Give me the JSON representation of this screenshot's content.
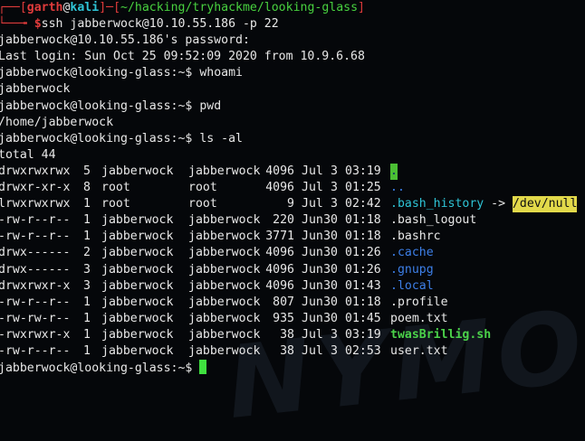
{
  "prompt_header": {
    "open": "┌──[",
    "user": "garth",
    "at": "@",
    "host": "kali",
    "mid": "]─[",
    "path": "~/hacking/tryhackme/looking-glass",
    "close": "]",
    "arrow": "└──╼ ",
    "dollar": "$",
    "command": "ssh jabberwock@10.10.55.186 -p 22"
  },
  "lines": {
    "password": "jabberwock@10.10.55.186's password:",
    "last_login": "Last login: Sun Oct 25 09:52:09 2020 from 10.9.6.68",
    "whoami_prompt": "jabberwock@looking-glass:~$ ",
    "whoami_cmd": "whoami",
    "whoami_out": "jabberwock",
    "pwd_prompt": "jabberwock@looking-glass:~$ ",
    "pwd_cmd": "pwd",
    "pwd_out": "/home/jabberwock",
    "ls_prompt": "jabberwock@looking-glass:~$ ",
    "ls_cmd": "ls -al",
    "total": "total 44",
    "final_prompt": "jabberwock@looking-glass:~$ "
  },
  "ls_rows": [
    {
      "perm": "drwxrwxrwx",
      "n": "5",
      "owner": "jabberwock",
      "group": "jabberwock",
      "size": "4096",
      "mon": "Jul",
      "day": "3",
      "time": "03:19",
      "name": ".",
      "kind": "dir-hl"
    },
    {
      "perm": "drwxr-xr-x",
      "n": "8",
      "owner": "root",
      "group": "root",
      "size": "4096",
      "mon": "Jul",
      "day": "3",
      "time": "01:25",
      "name": "..",
      "kind": "dir"
    },
    {
      "perm": "lrwxrwxrwx",
      "n": "1",
      "owner": "root",
      "group": "root",
      "size": "9",
      "mon": "Jul",
      "day": "3",
      "time": "02:42",
      "name": ".bash_history",
      "target": "/dev/null",
      "arrow": " -> ",
      "kind": "link"
    },
    {
      "perm": "-rw-r--r--",
      "n": "1",
      "owner": "jabberwock",
      "group": "jabberwock",
      "size": "220",
      "mon": "Jun",
      "day": "30",
      "time": "01:18",
      "name": ".bash_logout",
      "kind": "file"
    },
    {
      "perm": "-rw-r--r--",
      "n": "1",
      "owner": "jabberwock",
      "group": "jabberwock",
      "size": "3771",
      "mon": "Jun",
      "day": "30",
      "time": "01:18",
      "name": ".bashrc",
      "kind": "file"
    },
    {
      "perm": "drwx------",
      "n": "2",
      "owner": "jabberwock",
      "group": "jabberwock",
      "size": "4096",
      "mon": "Jun",
      "day": "30",
      "time": "01:26",
      "name": ".cache",
      "kind": "dir"
    },
    {
      "perm": "drwx------",
      "n": "3",
      "owner": "jabberwock",
      "group": "jabberwock",
      "size": "4096",
      "mon": "Jun",
      "day": "30",
      "time": "01:26",
      "name": ".gnupg",
      "kind": "dir"
    },
    {
      "perm": "drwxrwxr-x",
      "n": "3",
      "owner": "jabberwock",
      "group": "jabberwock",
      "size": "4096",
      "mon": "Jun",
      "day": "30",
      "time": "01:43",
      "name": ".local",
      "kind": "dir"
    },
    {
      "perm": "-rw-r--r--",
      "n": "1",
      "owner": "jabberwock",
      "group": "jabberwock",
      "size": "807",
      "mon": "Jun",
      "day": "30",
      "time": "01:18",
      "name": ".profile",
      "kind": "file"
    },
    {
      "perm": "-rw-rw-r--",
      "n": "1",
      "owner": "jabberwock",
      "group": "jabberwock",
      "size": "935",
      "mon": "Jun",
      "day": "30",
      "time": "01:45",
      "name": "poem.txt",
      "kind": "file"
    },
    {
      "perm": "-rwxrwxr-x",
      "n": "1",
      "owner": "jabberwock",
      "group": "jabberwock",
      "size": "38",
      "mon": "Jul",
      "day": "3",
      "time": "03:19",
      "name": "twasBrillig.sh",
      "kind": "exec"
    },
    {
      "perm": "-rw-r--r--",
      "n": "1",
      "owner": "jabberwock",
      "group": "jabberwock",
      "size": "38",
      "mon": "Jul",
      "day": "3",
      "time": "02:53",
      "name": "user.txt",
      "kind": "file"
    }
  ],
  "colors": {
    "background": "#05070a",
    "prompt_red": "#e03b3b",
    "prompt_user": "#48d13f",
    "directory": "#3d7fe8",
    "symlink": "#2ec4d6",
    "executable": "#4bd24a",
    "cursor": "#3fe03f"
  }
}
